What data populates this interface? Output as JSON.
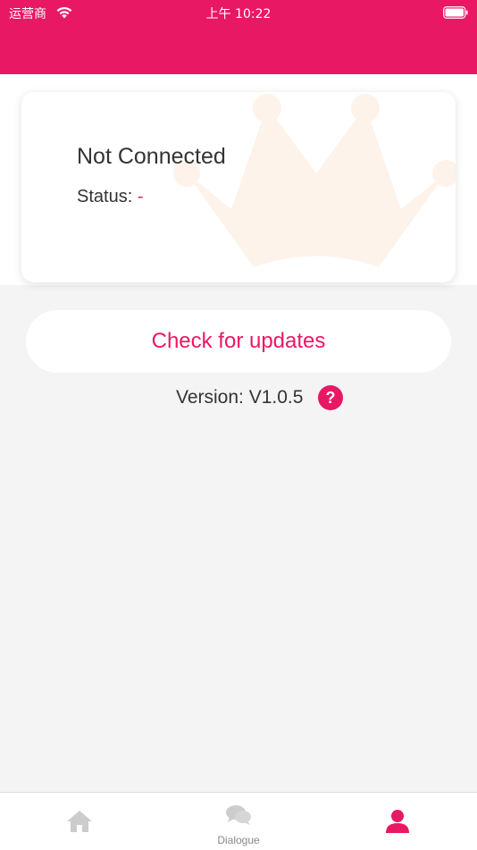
{
  "status_bar": {
    "carrier": "运营商",
    "time": "上午 10:22"
  },
  "connection": {
    "title": "Not Connected",
    "status_label": "Status: ",
    "status_value": "-"
  },
  "update": {
    "button_label": "Check for updates",
    "version_text": "Version: V1.0.5",
    "help_symbol": "?"
  },
  "tabbar": {
    "tabs": [
      {
        "id": "home",
        "label": "",
        "icon": "home-icon",
        "active": false
      },
      {
        "id": "dialogue",
        "label": "Dialogue",
        "icon": "chat-bubbles-icon",
        "active": false
      },
      {
        "id": "profile",
        "label": "",
        "icon": "person-icon",
        "active": true
      }
    ]
  },
  "colors": {
    "brand": "#e91864",
    "background": "#f4f4f4",
    "inactive_icon": "#cccccc",
    "crown_watermark": "#fdf3ea"
  }
}
